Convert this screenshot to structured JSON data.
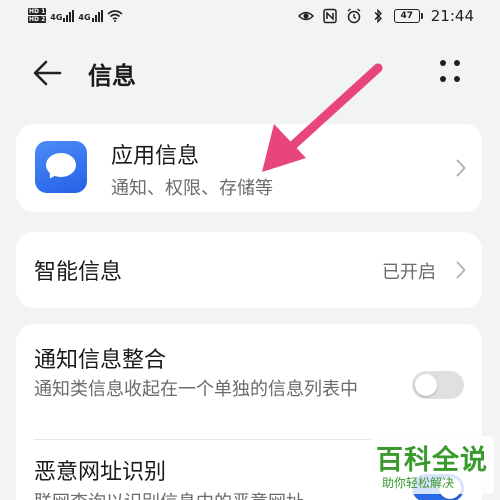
{
  "status_bar": {
    "hd1": "HD 1",
    "hd2": "HD 2",
    "net1": "4G",
    "net2": "4G",
    "battery": "47",
    "time": "21:44"
  },
  "header": {
    "title": "信息"
  },
  "app_info": {
    "title": "应用信息",
    "subtitle": "通知、权限、存储等"
  },
  "smart_info": {
    "title": "智能信息",
    "status": "已开启"
  },
  "merge": {
    "title": "通知信息整合",
    "description": "通知类信息收起在一个单独的信息列表中",
    "toggle_on": false
  },
  "malicious_url": {
    "title": "恶意网址识别",
    "description": "联网查询以识别信息中的恶意网址",
    "toggle_on": true
  },
  "watermark": {
    "big": "百科全说",
    "small": "助你轻松解决"
  },
  "colors": {
    "accent": "#2a6ae8",
    "arrow": "#e8457a",
    "watermark": "#3a9a2e"
  }
}
